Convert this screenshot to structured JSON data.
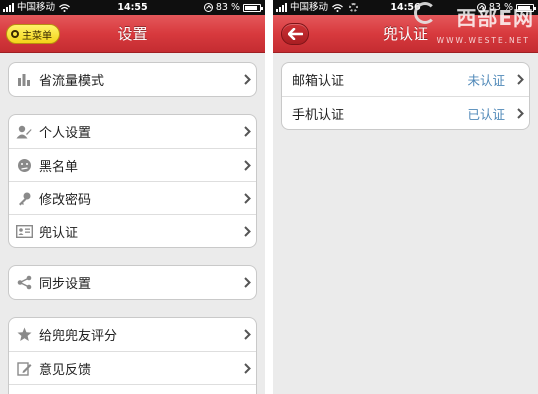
{
  "left_screen": {
    "status": {
      "carrier": "中国移动",
      "time": "14:55",
      "battery": "83 %"
    },
    "nav": {
      "menu_button": "主菜单",
      "title": "设置"
    },
    "groups": [
      {
        "items": [
          {
            "label": "省流量模式",
            "icon": "bar-chart-icon"
          }
        ]
      },
      {
        "items": [
          {
            "label": "个人设置",
            "icon": "user-icon"
          },
          {
            "label": "黑名单",
            "icon": "blocked-face-icon"
          },
          {
            "label": "修改密码",
            "icon": "key-icon"
          },
          {
            "label": "兜认证",
            "icon": "id-card-icon"
          }
        ]
      },
      {
        "items": [
          {
            "label": "同步设置",
            "icon": "share-icon"
          }
        ]
      },
      {
        "items": [
          {
            "label": "给兜兜友评分",
            "icon": "star-icon"
          },
          {
            "label": "意见反馈",
            "icon": "edit-icon"
          }
        ]
      }
    ]
  },
  "right_screen": {
    "status": {
      "carrier": "中国移动",
      "time": "14:56",
      "battery": "83 %"
    },
    "nav": {
      "title": "兜认证"
    },
    "items": [
      {
        "label": "邮箱认证",
        "value": "未认证"
      },
      {
        "label": "手机认证",
        "value": "已认证"
      }
    ]
  },
  "watermark": {
    "logo": "西部E网",
    "url": "WWW.WESTE.NET"
  },
  "colors": {
    "nav_red": "#d83a3e",
    "value_blue": "#4f88b8",
    "menu_yellow": "#f4d41a",
    "background": "#ebebeb"
  }
}
